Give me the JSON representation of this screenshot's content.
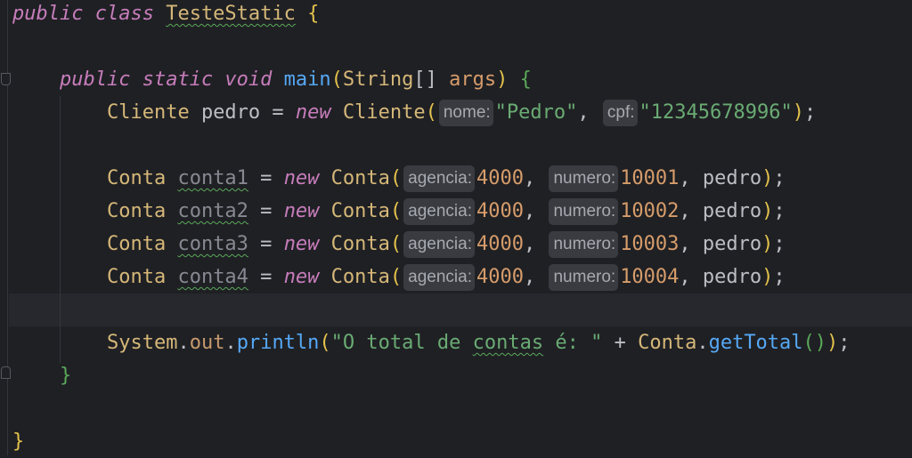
{
  "editor": {
    "lines": [
      [
        {
          "t": "public ",
          "c": "kw"
        },
        {
          "t": "class ",
          "c": "kw"
        },
        {
          "t": "TesteStatic",
          "c": "cls typo"
        },
        {
          "t": " "
        },
        {
          "t": "{",
          "c": "brace1"
        }
      ],
      [],
      [
        {
          "t": "    "
        },
        {
          "t": "public ",
          "c": "kw"
        },
        {
          "t": "static ",
          "c": "kw"
        },
        {
          "t": "void ",
          "c": "kw"
        },
        {
          "t": "main",
          "c": "fn"
        },
        {
          "t": "(",
          "c": "brace1"
        },
        {
          "t": "String",
          "c": "cls"
        },
        {
          "t": "[] "
        },
        {
          "t": "args",
          "c": "num"
        },
        {
          "t": ")",
          "c": "brace1"
        },
        {
          "t": " "
        },
        {
          "t": "{",
          "c": "brace2"
        }
      ],
      [
        {
          "t": "        "
        },
        {
          "t": "Cliente ",
          "c": "cls"
        },
        {
          "t": "pedro = "
        },
        {
          "t": "new ",
          "c": "kw"
        },
        {
          "t": "Cliente",
          "c": "cls"
        },
        {
          "t": "(",
          "c": "brace1"
        },
        {
          "hint": "nome:"
        },
        {
          "t": "\"Pedro\"",
          "c": "str"
        },
        {
          "t": ", "
        },
        {
          "hint": "cpf:"
        },
        {
          "t": "\"12345678996\"",
          "c": "str"
        },
        {
          "t": ")",
          "c": "brace1"
        },
        {
          "t": ";"
        }
      ],
      [],
      [
        {
          "t": "        "
        },
        {
          "t": "Conta ",
          "c": "cls"
        },
        {
          "t": "conta1",
          "c": "unused typo"
        },
        {
          "t": " = "
        },
        {
          "t": "new ",
          "c": "kw"
        },
        {
          "t": "Conta",
          "c": "cls"
        },
        {
          "t": "(",
          "c": "brace1"
        },
        {
          "hint": "agencia:"
        },
        {
          "t": "4000",
          "c": "num"
        },
        {
          "t": ", "
        },
        {
          "hint": "numero:"
        },
        {
          "t": "10001",
          "c": "num"
        },
        {
          "t": ", pedro"
        },
        {
          "t": ")",
          "c": "brace1"
        },
        {
          "t": ";"
        }
      ],
      [
        {
          "t": "        "
        },
        {
          "t": "Conta ",
          "c": "cls"
        },
        {
          "t": "conta2",
          "c": "unused typo"
        },
        {
          "t": " = "
        },
        {
          "t": "new ",
          "c": "kw"
        },
        {
          "t": "Conta",
          "c": "cls"
        },
        {
          "t": "(",
          "c": "brace1"
        },
        {
          "hint": "agencia:"
        },
        {
          "t": "4000",
          "c": "num"
        },
        {
          "t": ", "
        },
        {
          "hint": "numero:"
        },
        {
          "t": "10002",
          "c": "num"
        },
        {
          "t": ", pedro"
        },
        {
          "t": ")",
          "c": "brace1"
        },
        {
          "t": ";"
        }
      ],
      [
        {
          "t": "        "
        },
        {
          "t": "Conta ",
          "c": "cls"
        },
        {
          "t": "conta3",
          "c": "unused typo"
        },
        {
          "t": " = "
        },
        {
          "t": "new ",
          "c": "kw"
        },
        {
          "t": "Conta",
          "c": "cls"
        },
        {
          "t": "(",
          "c": "brace1"
        },
        {
          "hint": "agencia:"
        },
        {
          "t": "4000",
          "c": "num"
        },
        {
          "t": ", "
        },
        {
          "hint": "numero:"
        },
        {
          "t": "10003",
          "c": "num"
        },
        {
          "t": ", pedro"
        },
        {
          "t": ")",
          "c": "brace1"
        },
        {
          "t": ";"
        }
      ],
      [
        {
          "t": "        "
        },
        {
          "t": "Conta ",
          "c": "cls"
        },
        {
          "t": "conta4",
          "c": "unused typo"
        },
        {
          "t": " = "
        },
        {
          "t": "new ",
          "c": "kw"
        },
        {
          "t": "Conta",
          "c": "cls"
        },
        {
          "t": "(",
          "c": "brace1"
        },
        {
          "hint": "agencia:"
        },
        {
          "t": "4000",
          "c": "num"
        },
        {
          "t": ", "
        },
        {
          "hint": "numero:"
        },
        {
          "t": "10004",
          "c": "num"
        },
        {
          "t": ", pedro"
        },
        {
          "t": ")",
          "c": "brace1"
        },
        {
          "t": ";"
        }
      ],
      [],
      [
        {
          "t": "        "
        },
        {
          "t": "System",
          "c": "cls"
        },
        {
          "t": "."
        },
        {
          "t": "out",
          "c": "field"
        },
        {
          "t": "."
        },
        {
          "t": "println",
          "c": "fn"
        },
        {
          "t": "(",
          "c": "brace1"
        },
        {
          "t": "\"O total de ",
          "c": "str"
        },
        {
          "t": "contas",
          "c": "str typo"
        },
        {
          "t": " é: \"",
          "c": "str"
        },
        {
          "t": " + "
        },
        {
          "t": "Conta",
          "c": "cls"
        },
        {
          "t": "."
        },
        {
          "t": "getTotal",
          "c": "fn"
        },
        {
          "t": "()",
          "c": "brace2"
        },
        {
          "t": ")",
          "c": "brace1"
        },
        {
          "t": ";"
        }
      ],
      [
        {
          "t": "    "
        },
        {
          "t": "}",
          "c": "brace2"
        }
      ],
      [],
      [
        {
          "t": "}",
          "c": "brace1"
        }
      ]
    ],
    "current_line": 10,
    "colors": {
      "background": "#1f2024",
      "keyword": "#c77dbb",
      "class": "#d5b778",
      "method": "#56a8f5",
      "string": "#6aab73",
      "number": "#d69c6a"
    }
  }
}
